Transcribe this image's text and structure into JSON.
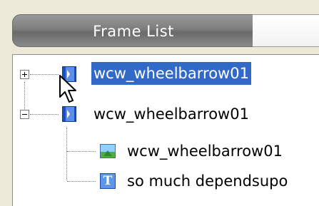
{
  "window": {
    "tab_label": "Frame List"
  },
  "tree": {
    "items": [
      {
        "label": "wcw_wheelbarrow01",
        "icon": "film-icon",
        "expander": "plus",
        "selected": true
      },
      {
        "label": "wcw_wheelbarrow01",
        "icon": "film-icon",
        "expander": "minus",
        "selected": false
      },
      {
        "label": "wcw_wheelbarrow01",
        "icon": "image-icon",
        "child": true
      },
      {
        "label": "so much dependsupo",
        "icon": "text-icon",
        "child": true
      }
    ]
  },
  "colors": {
    "selection": "#3169c6",
    "panel_bg": "#ece9d8",
    "tab_bg": "#7d7d7d"
  },
  "icons": {
    "text_glyph": "T"
  }
}
